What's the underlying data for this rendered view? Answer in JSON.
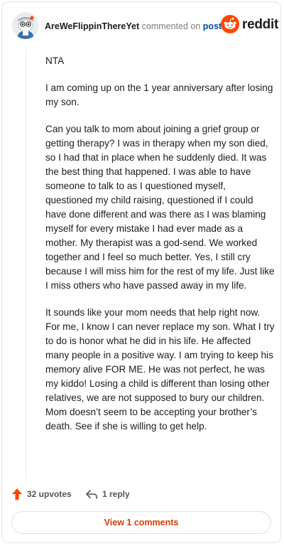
{
  "header": {
    "username": "AreWeFlippinThereYet",
    "action_text": "commented on",
    "post_link": "post",
    "brand": "reddit"
  },
  "comment": {
    "paragraphs": [
      "NTA",
      "I am coming up on the 1 year anniversary after losing my son.",
      "Can you talk to mom about joining a grief group or getting therapy? I was in therapy when my son died, so I had that in place when he suddenly died. It was the best thing that happened. I was able to have someone to talk to as I questioned myself, questioned my child raising, questioned if I could have done different and was there as I was blaming myself for every mistake I had ever made as a mother. My therapist was a god-send. We worked together and I feel so much better. Yes, I still cry because I will miss him for the rest of my life. Just like I miss others who have passed away in my life.",
      "It sounds like your mom needs that help right now. For me, I know I can never replace my son. What I try to do is honor what he did in his life. He affected many people in a positive way. I am trying to keep his memory alive FOR ME. He was not perfect, he was my kiddo! Losing a child is different than losing other relatives, we are not supposed to bury our children. Mom doesn’t seem to be accepting your brother’s death. See if she is willing to get help."
    ]
  },
  "actions": {
    "upvotes": "32 upvotes",
    "replies": "1 reply"
  },
  "footer": {
    "view_comments": "View 1 comments"
  },
  "colors": {
    "accent": "#ff4500",
    "link": "#0045ac",
    "view_button_text": "#d93a00"
  }
}
